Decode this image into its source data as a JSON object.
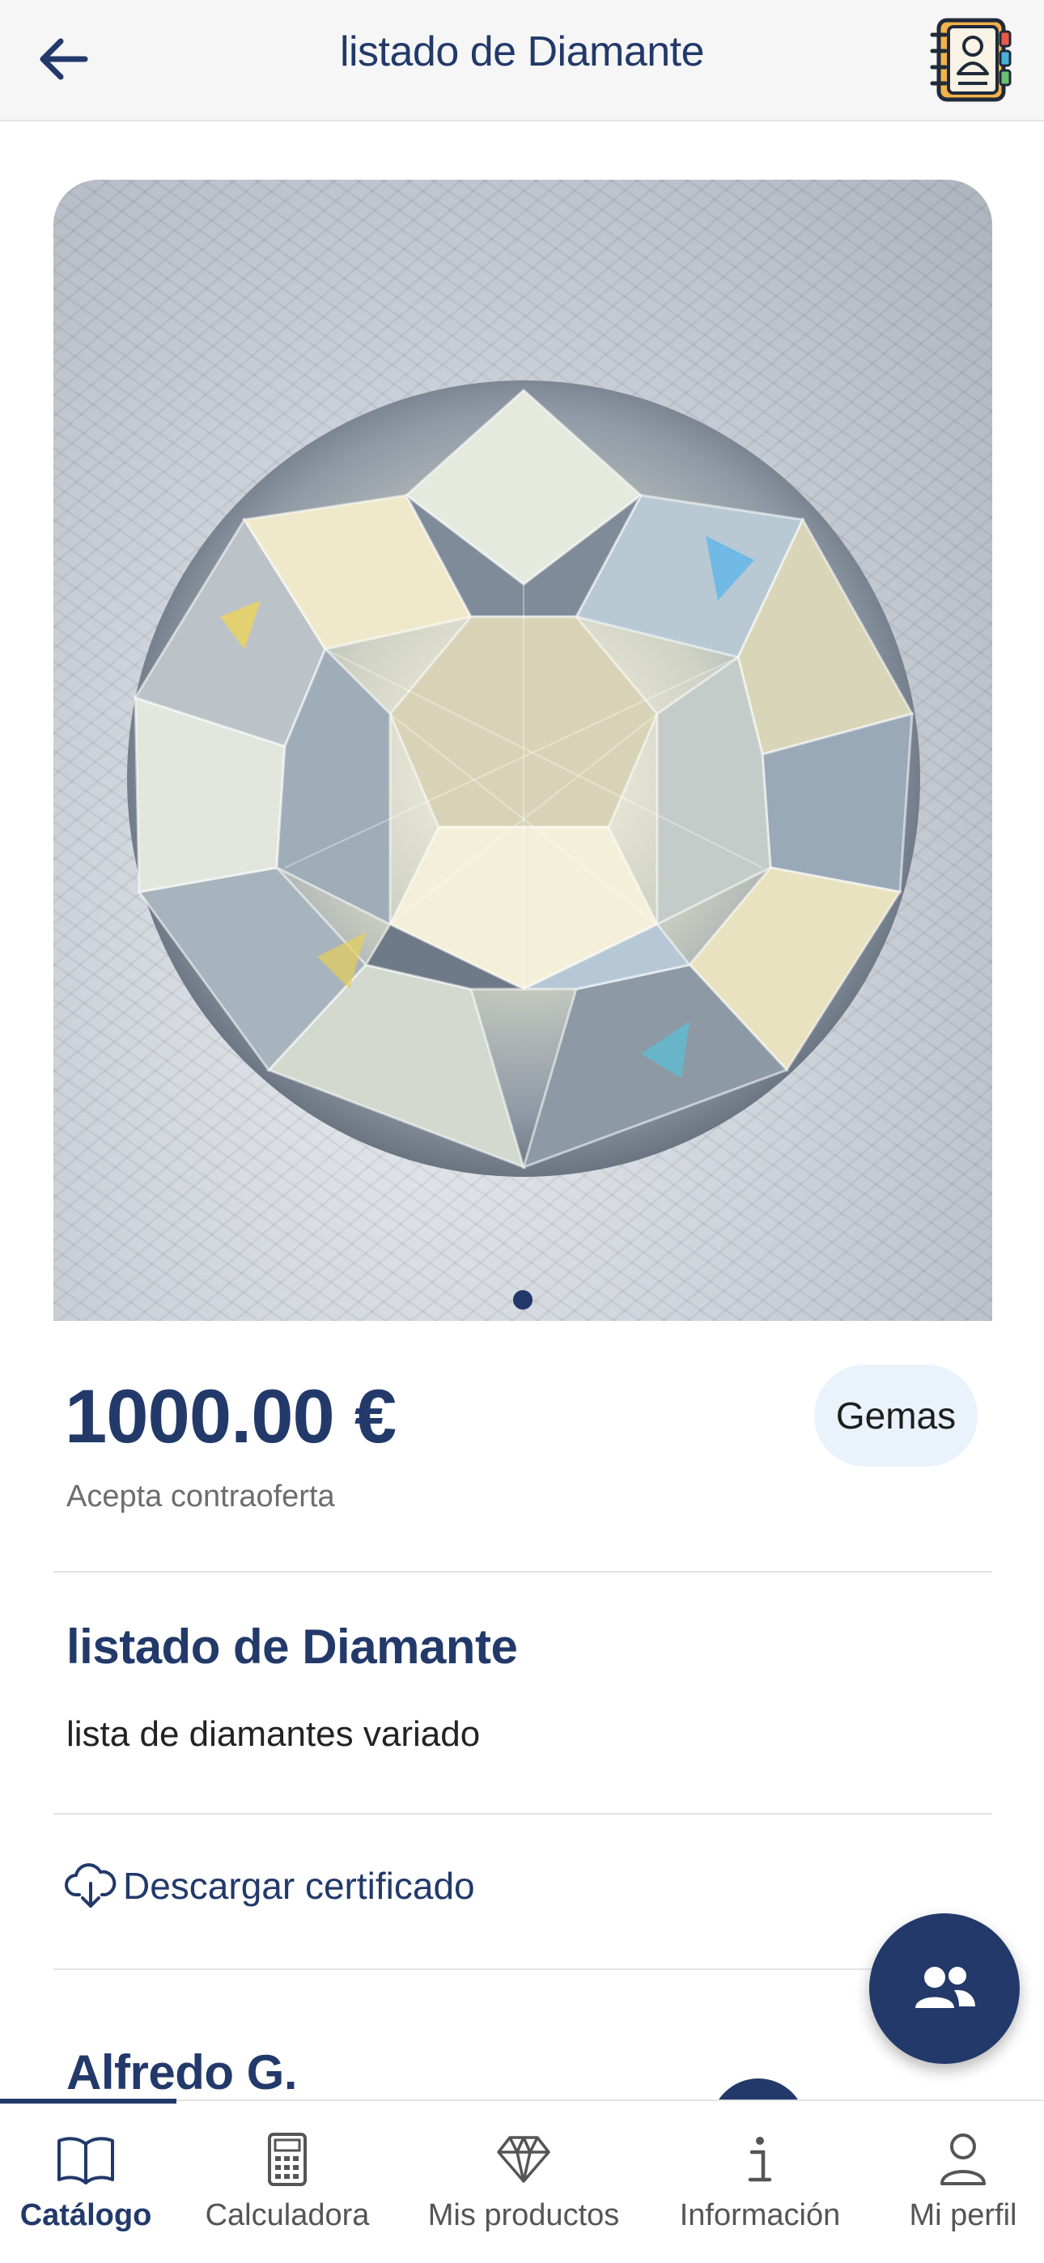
{
  "header": {
    "title": "listado de Diamante",
    "back_icon": "arrow-left-icon",
    "contacts_icon": "address-book-icon"
  },
  "carousel": {
    "image": "diamond-photo",
    "current_index": 1,
    "total": 1
  },
  "product": {
    "price": "1000.00 €",
    "counteroffer": "Acepta contraoferta",
    "category": "Gemas",
    "title": "listado de Diamante",
    "description": "lista de diamantes variado"
  },
  "actions": {
    "download_label": "Descargar certificado",
    "download_icon": "cloud-download-icon",
    "fab_icon": "users-icon"
  },
  "seller": {
    "name": "Alfredo G."
  },
  "bottom_nav": {
    "items": [
      {
        "label": "Catálogo",
        "icon": "book-open-icon",
        "active": true
      },
      {
        "label": "Calculadora",
        "icon": "calculator-icon",
        "active": false
      },
      {
        "label": "Mis productos",
        "icon": "diamond-icon",
        "active": false
      },
      {
        "label": "Información",
        "icon": "info-icon",
        "active": false
      },
      {
        "label": "Mi perfil",
        "icon": "user-icon",
        "active": false
      }
    ]
  },
  "colors": {
    "primary": "#22396a",
    "chip_bg": "#eaf3fb",
    "muted_text": "#6d6d6d"
  }
}
